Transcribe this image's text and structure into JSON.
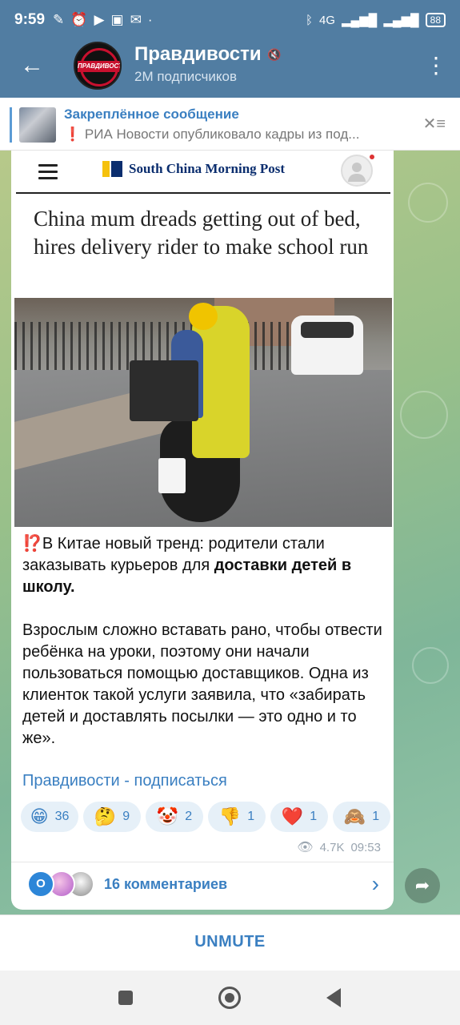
{
  "statusbar": {
    "time": "9:59",
    "network": "4G",
    "battery": "88"
  },
  "header": {
    "back_icon": "arrow-left-icon",
    "avatar_logo": "ПРАВДИВОСТИ",
    "title": "Правдивости",
    "subtitle": "2M подписчиков",
    "menu_icon": "more-vert-icon"
  },
  "pinned": {
    "title": "Закреплённое сообщение",
    "text": "❗ РИА Новости опубликовало кадры из под..."
  },
  "post": {
    "screenshot": {
      "logo_text": "South China Morning Post",
      "headline": "China mum dreads getting out of bed, hires delivery rider to make school run"
    },
    "para1_prefix": "⁉️В Китае новый тренд: родители стали заказывать курьеров для ",
    "para1_bold": "доставки детей в школу.",
    "para2": "Взрослым сложно вставать рано, чтобы отвести ребёнка на уроки, поэтому они начали пользоваться помощью доставщиков. Одна из клиенток такой услуги заявила, что «забирать детей и доставлять посылки — это одно и то же».",
    "link": "Правдивости - подписаться",
    "reactions": [
      {
        "emoji": "😁",
        "count": "36"
      },
      {
        "emoji": "🤔",
        "count": "9"
      },
      {
        "emoji": "🤡",
        "count": "2"
      },
      {
        "emoji": "👎",
        "count": "1"
      },
      {
        "emoji": "❤️",
        "count": "1"
      },
      {
        "emoji": "🙈",
        "count": "1"
      }
    ],
    "views": "4.7K",
    "time": "09:53",
    "comments_label": "16 комментариев",
    "comment_avatar_letter": "O"
  },
  "bottom": {
    "unmute": "UNMUTE"
  }
}
